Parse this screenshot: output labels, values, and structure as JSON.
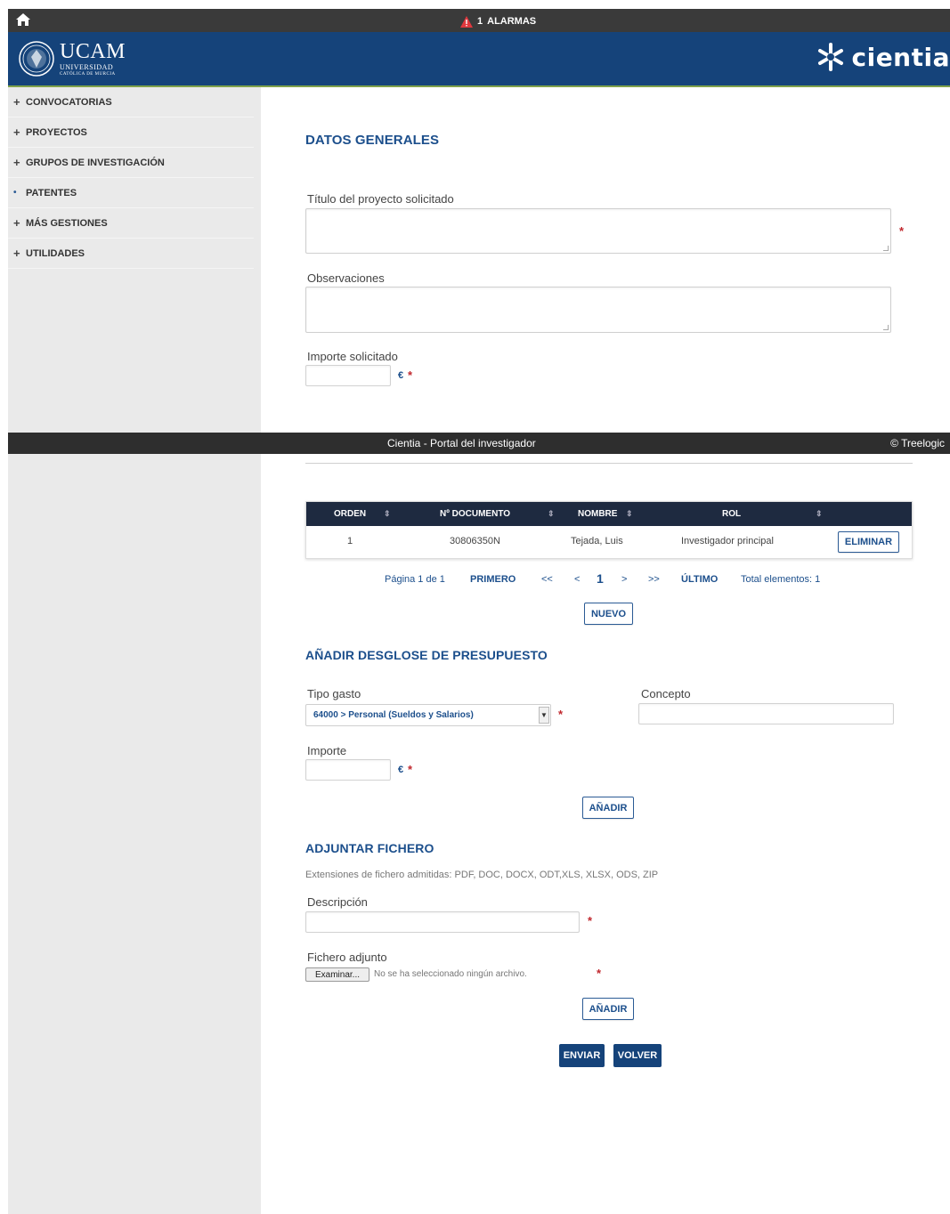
{
  "topbar": {
    "home_icon": "home-icon",
    "alarm_count": "1",
    "alarms_label": "ALARMAS"
  },
  "header": {
    "ucam_name": "UCAM",
    "ucam_sub": "UNIVERSIDAD",
    "ucam_sub2": "CATÓLICA DE MURCIA",
    "cientia_name": "cientia",
    "bg_color": "#15437a"
  },
  "sidebar": {
    "items": [
      {
        "symbol": "+",
        "label": "CONVOCATORIAS"
      },
      {
        "symbol": "+",
        "label": "PROYECTOS"
      },
      {
        "symbol": "+",
        "label": "GRUPOS DE INVESTIGACIÓN"
      },
      {
        "symbol": "•",
        "label": "PATENTES"
      },
      {
        "symbol": "+",
        "label": "MÁS GESTIONES"
      },
      {
        "symbol": "+",
        "label": "UTILIDADES"
      }
    ]
  },
  "datos_generales": {
    "title": "DATOS GENERALES",
    "titulo_label": "Título del proyecto solicitado",
    "titulo_value": "",
    "observaciones_label": "Observaciones",
    "observaciones_value": "",
    "importe_label": "Importe solicitado",
    "importe_value": "",
    "currency": "€",
    "required_mark": "*"
  },
  "footer": {
    "center": "Cientia - Portal del investigador",
    "right": "© Treelogic"
  },
  "table": {
    "headers": [
      "ORDEN",
      "Nº DOCUMENTO",
      "NOMBRE",
      "ROL"
    ],
    "rows": [
      {
        "orden": "1",
        "documento": "30806350N",
        "nombre": "Tejada, Luis",
        "rol": "Investigador principal",
        "action": "ELIMINAR"
      }
    ]
  },
  "pager": {
    "page_info": "Página 1 de 1",
    "first": "PRIMERO",
    "prev_prev": "<<",
    "prev": "<",
    "current": "1",
    "next": ">",
    "next_next": ">>",
    "last": "ÚLTIMO",
    "total": "Total elementos: 1"
  },
  "nuevo_label": "NUEVO",
  "desglose": {
    "title": "AÑADIR DESGLOSE DE PRESUPUESTO",
    "tipo_label": "Tipo gasto",
    "tipo_selected": "64000 > Personal (Sueldos y Salarios)",
    "concepto_label": "Concepto",
    "concepto_value": "",
    "importe_label": "Importe",
    "importe_value": "",
    "add_label": "AÑADIR"
  },
  "adjuntar": {
    "title": "ADJUNTAR FICHERO",
    "extensions": "Extensiones de fichero admitidas: PDF, DOC, DOCX, ODT,XLS, XLSX, ODS, ZIP",
    "descripcion_label": "Descripción",
    "descripcion_value": "",
    "fichero_label": "Fichero adjunto",
    "browse_label": "Examinar...",
    "no_file": "No se ha seleccionado ningún archivo.",
    "add_label": "AÑADIR"
  },
  "actions": {
    "enviar": "ENVIAR",
    "volver": "VOLVER"
  }
}
